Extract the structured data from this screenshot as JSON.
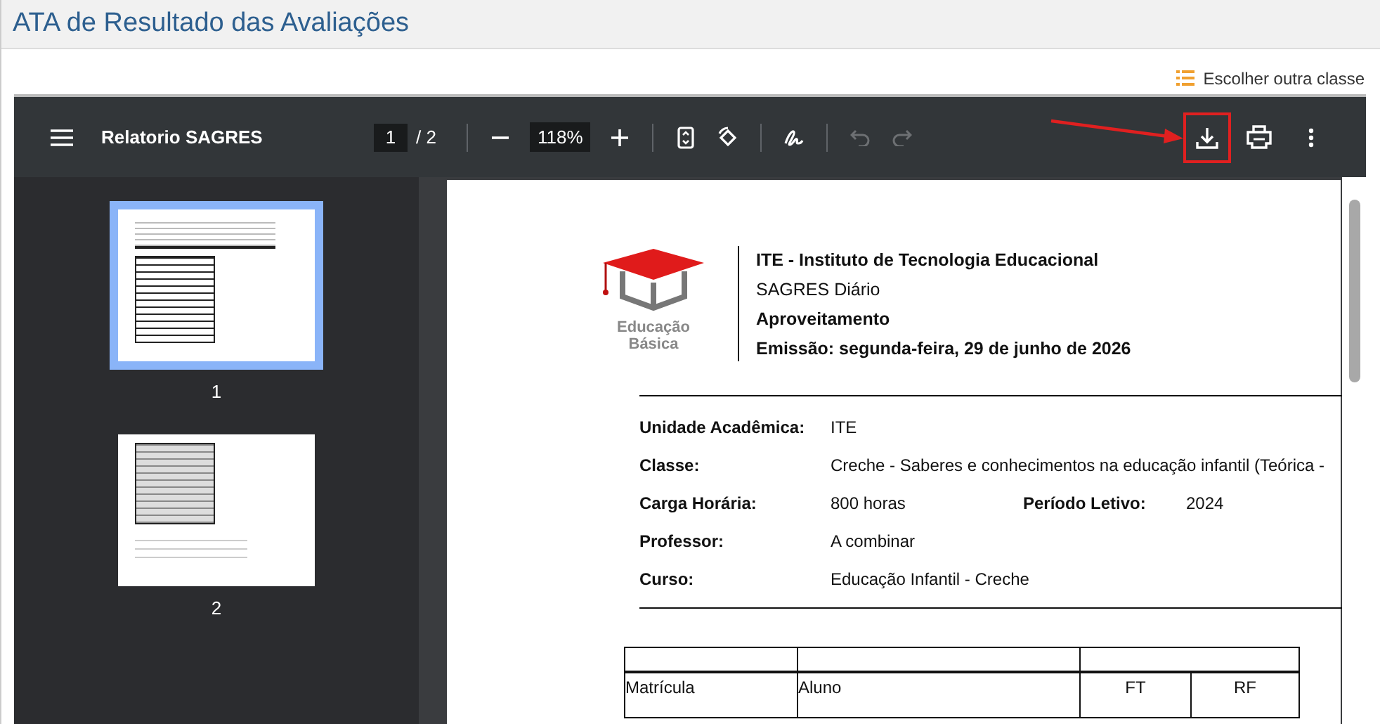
{
  "page_title": "ATA de Resultado das Avaliações",
  "choose_class_link": "Escolher outra classe",
  "viewer": {
    "title": "Relatorio SAGRES",
    "page_input": "1",
    "page_total": "/ 2",
    "zoom": "118%",
    "tools": [
      {
        "kind": "fit",
        "disabled": false,
        "highlighted": false
      },
      {
        "kind": "rotate",
        "disabled": false,
        "highlighted": false
      },
      {
        "kind": "sep"
      },
      {
        "kind": "annotate",
        "disabled": false,
        "highlighted": false
      },
      {
        "kind": "sep"
      },
      {
        "kind": "undo",
        "disabled": true,
        "highlighted": false
      },
      {
        "kind": "redo",
        "disabled": true,
        "highlighted": false
      }
    ],
    "actions": [
      {
        "kind": "download",
        "highlighted": true
      },
      {
        "kind": "print",
        "highlighted": false
      },
      {
        "kind": "more",
        "highlighted": false
      }
    ],
    "thumbnails": [
      {
        "label": "1",
        "selected": true
      },
      {
        "label": "2",
        "selected": false
      }
    ]
  },
  "document": {
    "logo_text": "Educação Básica",
    "header_lines": [
      {
        "text": "ITE - Instituto de Tecnologia Educacional",
        "bold": true
      },
      {
        "text": "SAGRES Diário",
        "bold": false
      },
      {
        "text": "Aproveitamento",
        "bold": true
      },
      {
        "text": "Emissão: segunda-feira, 29 de junho de 2026",
        "bold": true
      }
    ],
    "fields": [
      {
        "label": "Unidade Acadêmica:",
        "value": "ITE"
      },
      {
        "label": "Classe:",
        "value": "Creche - Saberes e conhecimentos na educação infantil (Teórica -"
      },
      {
        "label": "Carga Horária:",
        "value": "800 horas",
        "label_2": "Período Letivo:",
        "value_2": "2024"
      },
      {
        "label": "Professor:",
        "value": "A combinar"
      },
      {
        "label": "Curso:",
        "value": "Educação Infantil - Creche"
      }
    ],
    "table_columns": [
      "Matrícula",
      "Aluno",
      "FT",
      "RF"
    ]
  }
}
